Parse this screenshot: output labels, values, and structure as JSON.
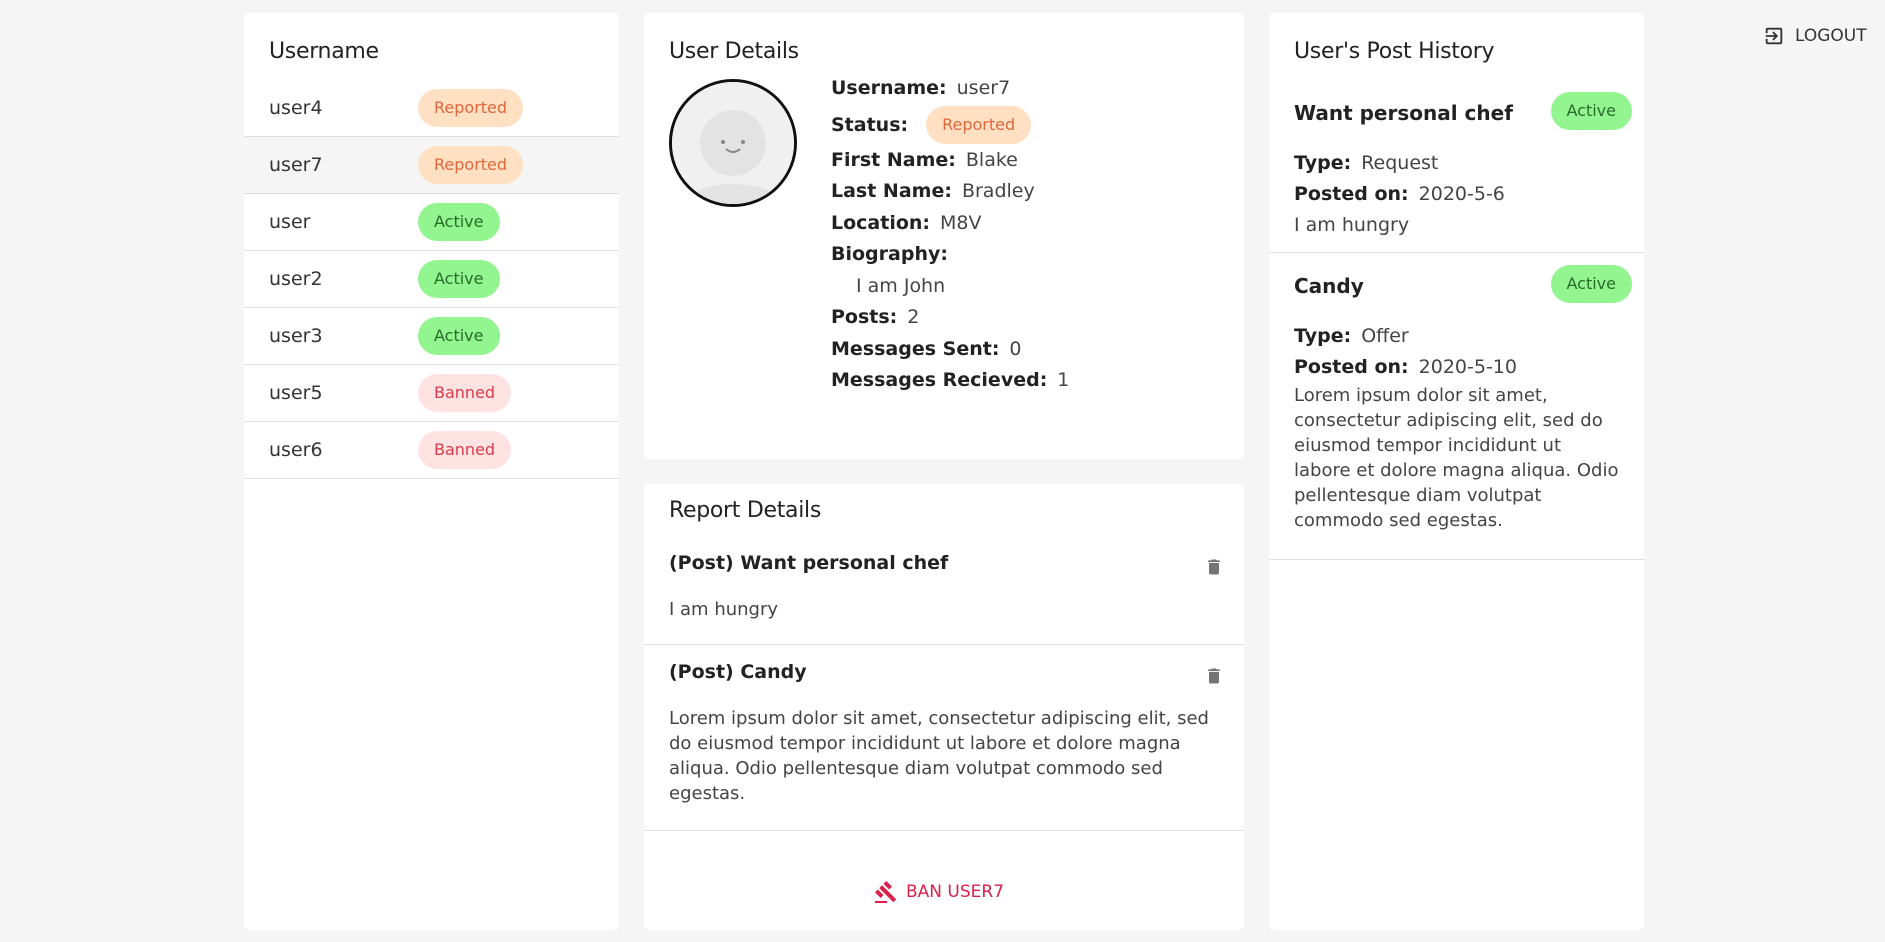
{
  "users_panel": {
    "title": "Username",
    "users": [
      {
        "name": "user4",
        "status": "Reported",
        "kind": "reported"
      },
      {
        "name": "user7",
        "status": "Reported",
        "kind": "reported"
      },
      {
        "name": "user",
        "status": "Active",
        "kind": "active"
      },
      {
        "name": "user2",
        "status": "Active",
        "kind": "active"
      },
      {
        "name": "user3",
        "status": "Active",
        "kind": "active"
      },
      {
        "name": "user5",
        "status": "Banned",
        "kind": "banned"
      },
      {
        "name": "user6",
        "status": "Banned",
        "kind": "banned"
      }
    ],
    "selected_index": 1
  },
  "user_details": {
    "title": "User Details",
    "username_label": "Username:",
    "username": "user7",
    "status_label": "Status:",
    "status": "Reported",
    "first_name_label": "First Name:",
    "first_name": "Blake",
    "last_name_label": "Last Name:",
    "last_name": "Bradley",
    "location_label": "Location:",
    "location": "M8V",
    "biography_label": "Biography:",
    "biography": "I am John",
    "posts_label": "Posts:",
    "posts": "2",
    "messages_sent_label": "Messages Sent:",
    "messages_sent": "0",
    "messages_received_label": "Messages Recieved:",
    "messages_received": "1"
  },
  "report_details": {
    "title": "Report Details",
    "reports": [
      {
        "title": "(Post) Want personal chef",
        "body": "I am hungry"
      },
      {
        "title": "(Post) Candy",
        "body": "Lorem ipsum dolor sit amet, consectetur adipiscing elit, sed do eiusmod tempor incididunt ut labore et dolore magna aliqua. Odio pellentesque diam volutpat commodo sed egestas."
      }
    ],
    "ban_label": "BAN USER7"
  },
  "post_history": {
    "title": "User's Post History",
    "type_label": "Type:",
    "posted_label": "Posted on:",
    "posts": [
      {
        "title": "Want personal chef",
        "status": "Active",
        "type": "Request",
        "posted_on": "2020-5-6",
        "description": "I am hungry"
      },
      {
        "title": "Candy",
        "status": "Active",
        "type": "Offer",
        "posted_on": "2020-5-10",
        "description": "Lorem ipsum dolor sit amet, consectetur adipiscing elit, sed do eiusmod tempor incididunt ut labore et dolore magna aliqua. Odio pellentesque diam volutpat commodo sed egestas."
      }
    ]
  },
  "header": {
    "logout_label": "LOGOUT",
    "logout_icon": "logout-icon"
  },
  "colors": {
    "reported_bg": "#ffe0c2",
    "active_bg": "#92f58f",
    "banned_bg": "#ffe2e2",
    "ban_accent": "#dc1f4b"
  }
}
